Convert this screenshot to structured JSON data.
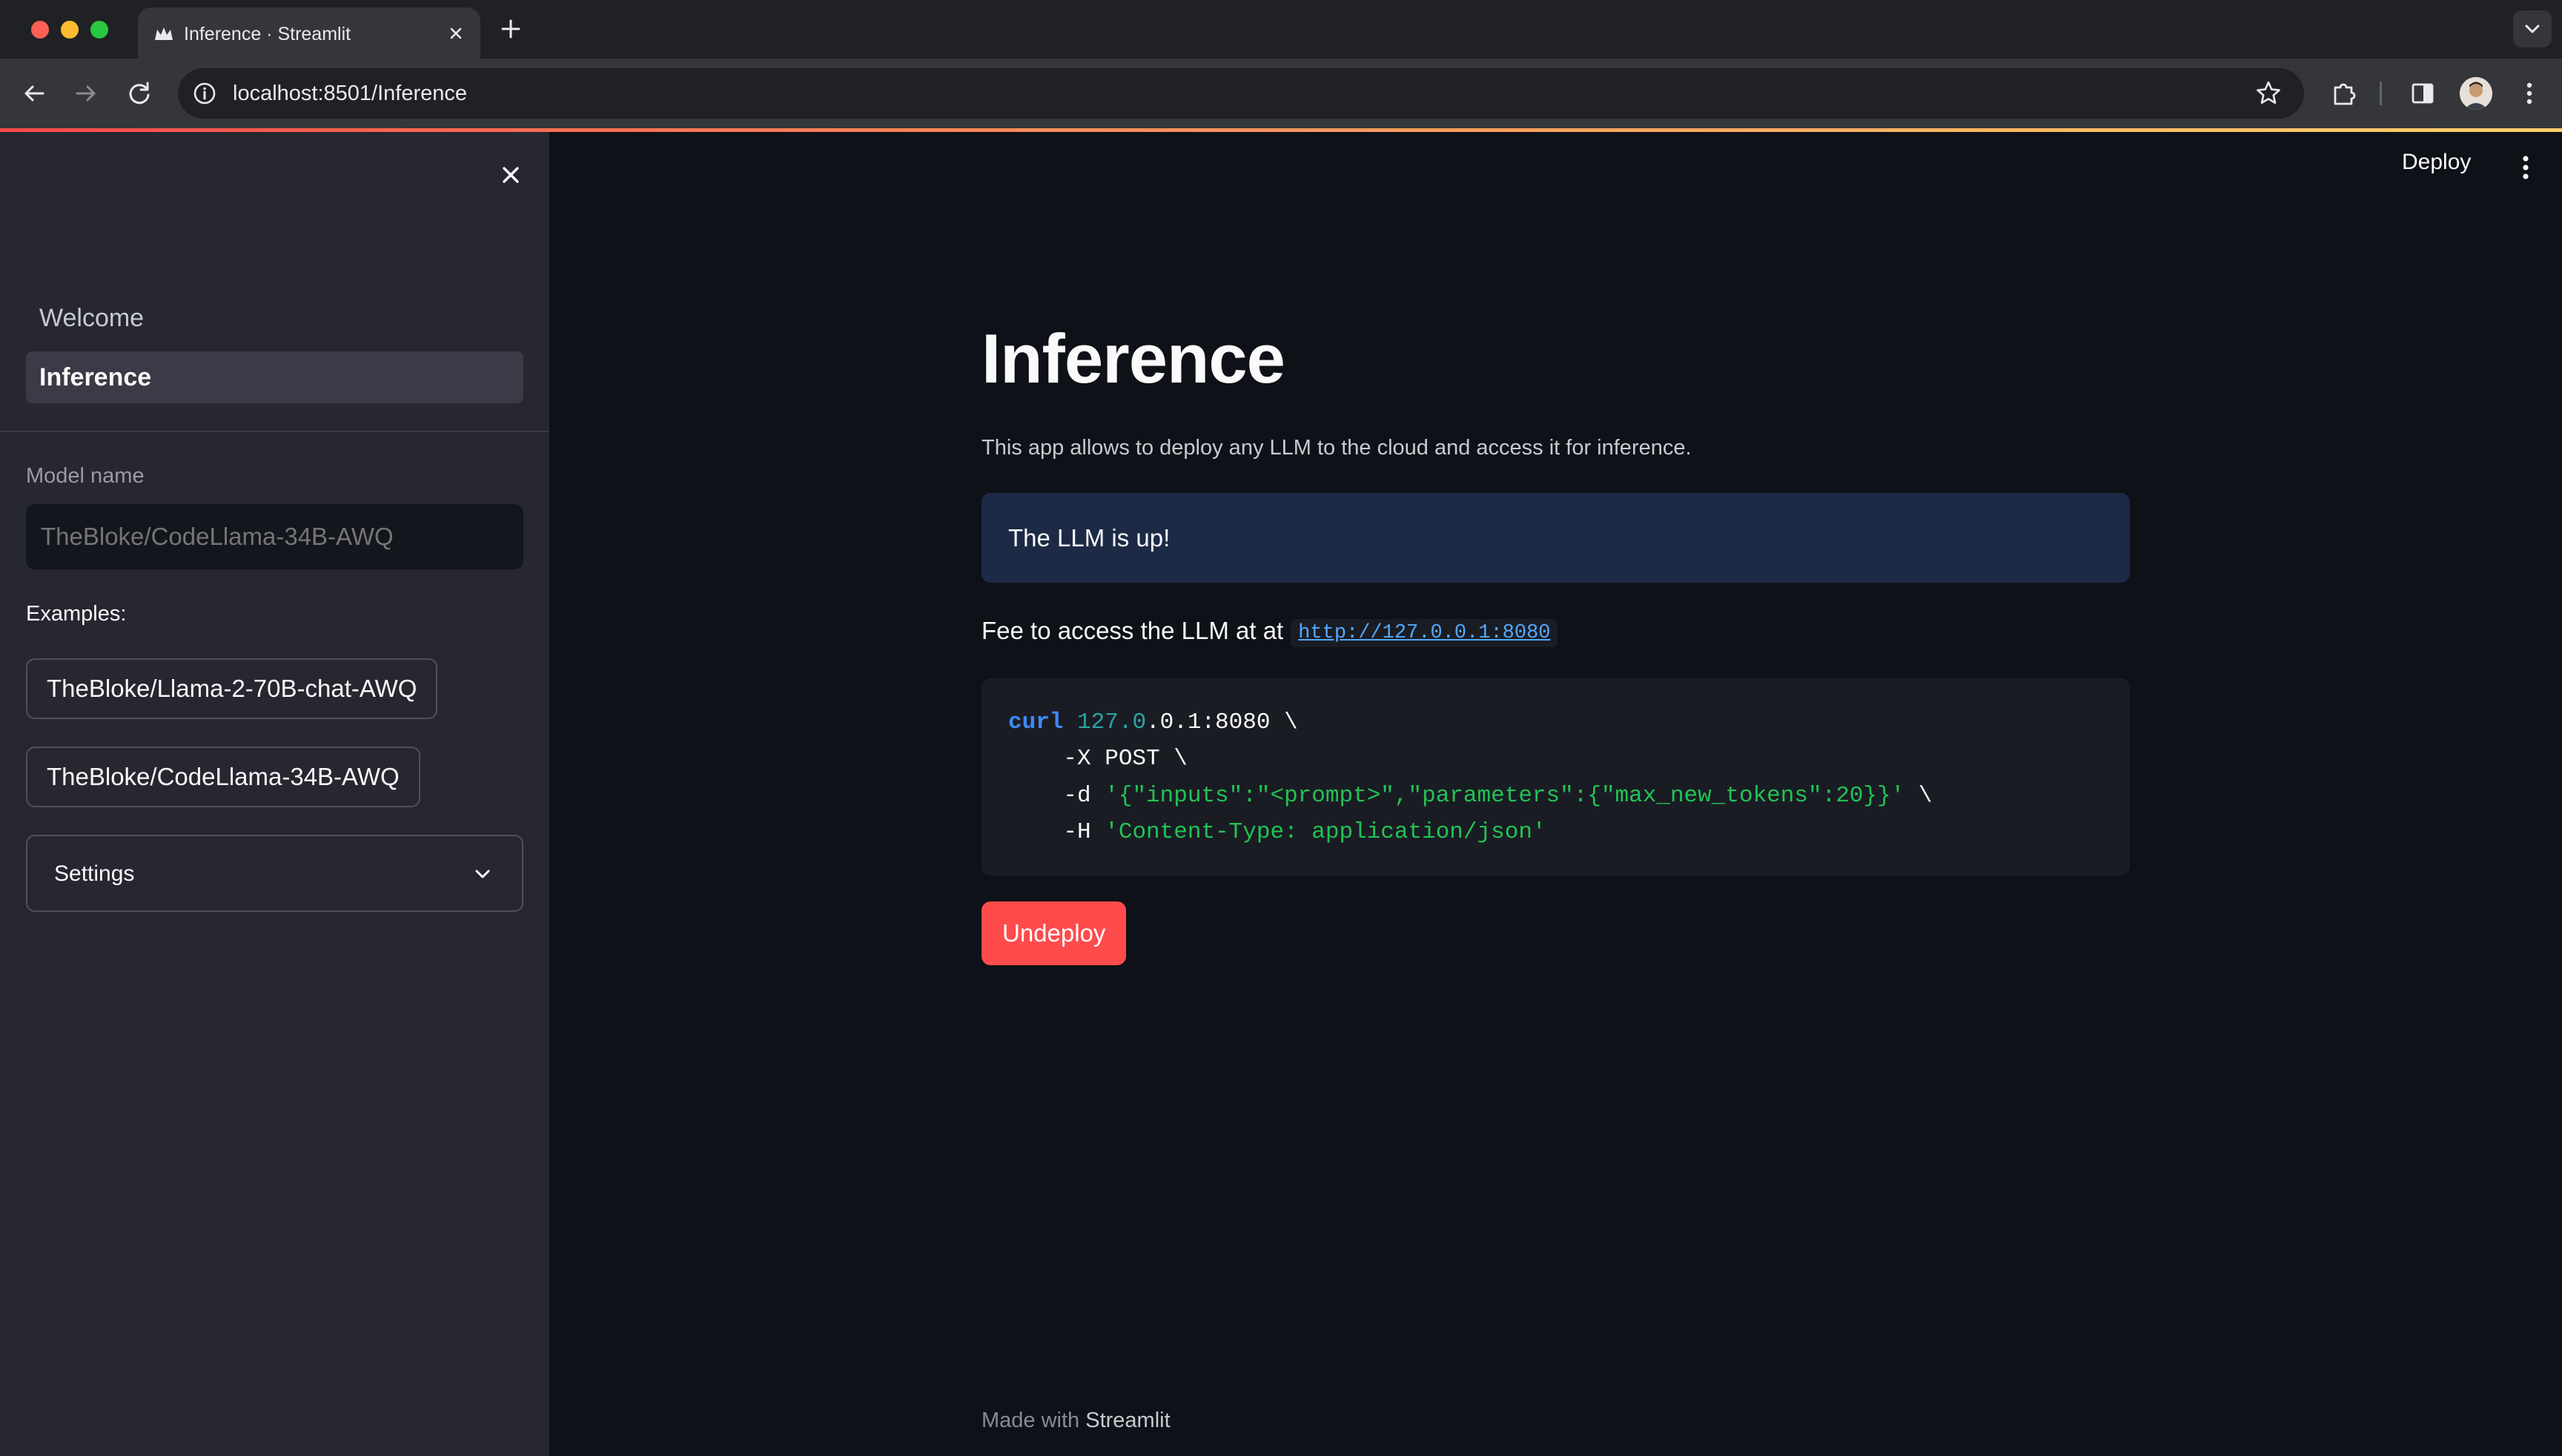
{
  "browser": {
    "tab_title": "Inference · Streamlit",
    "url": "localhost:8501/Inference"
  },
  "sidebar": {
    "nav_items": [
      {
        "label": "Welcome",
        "active": false
      },
      {
        "label": "Inference",
        "active": true
      }
    ],
    "model_name_label": "Model name",
    "model_name_placeholder": "TheBloke/CodeLlama-34B-AWQ",
    "examples_label": "Examples:",
    "examples": [
      "TheBloke/Llama-2-70B-chat-AWQ",
      "TheBloke/CodeLlama-34B-AWQ"
    ],
    "settings_label": "Settings"
  },
  "header": {
    "deploy_label": "Deploy"
  },
  "main": {
    "title": "Inference",
    "description": "This app allows to deploy any LLM to the cloud and access it for inference.",
    "status_message": "The LLM is up!",
    "access_text": "Fee to access the LLM at at",
    "access_link": "http://127.0.0.1:8080",
    "code": {
      "l1_cmd": "curl",
      "l1_num": "127.0",
      "l1_rest": ".0.1:8080 \\",
      "l2": "    -X POST \\",
      "l3_flag": "    -d ",
      "l3_str": "'{\"inputs\":\"<prompt>\",\"parameters\":{\"max_new_tokens\":20}}'",
      "l3_end": " \\",
      "l4_flag": "    -H ",
      "l4_str": "'Content-Type: application/json'"
    },
    "undeploy_label": "Undeploy"
  },
  "footer": {
    "made_with": "Made with",
    "brand": "Streamlit"
  },
  "colors": {
    "accent": "#ff4b4b",
    "background": "#0e1117",
    "sidebar": "#262730",
    "info_bg": "#1c2a46",
    "link": "#54a9ff"
  }
}
